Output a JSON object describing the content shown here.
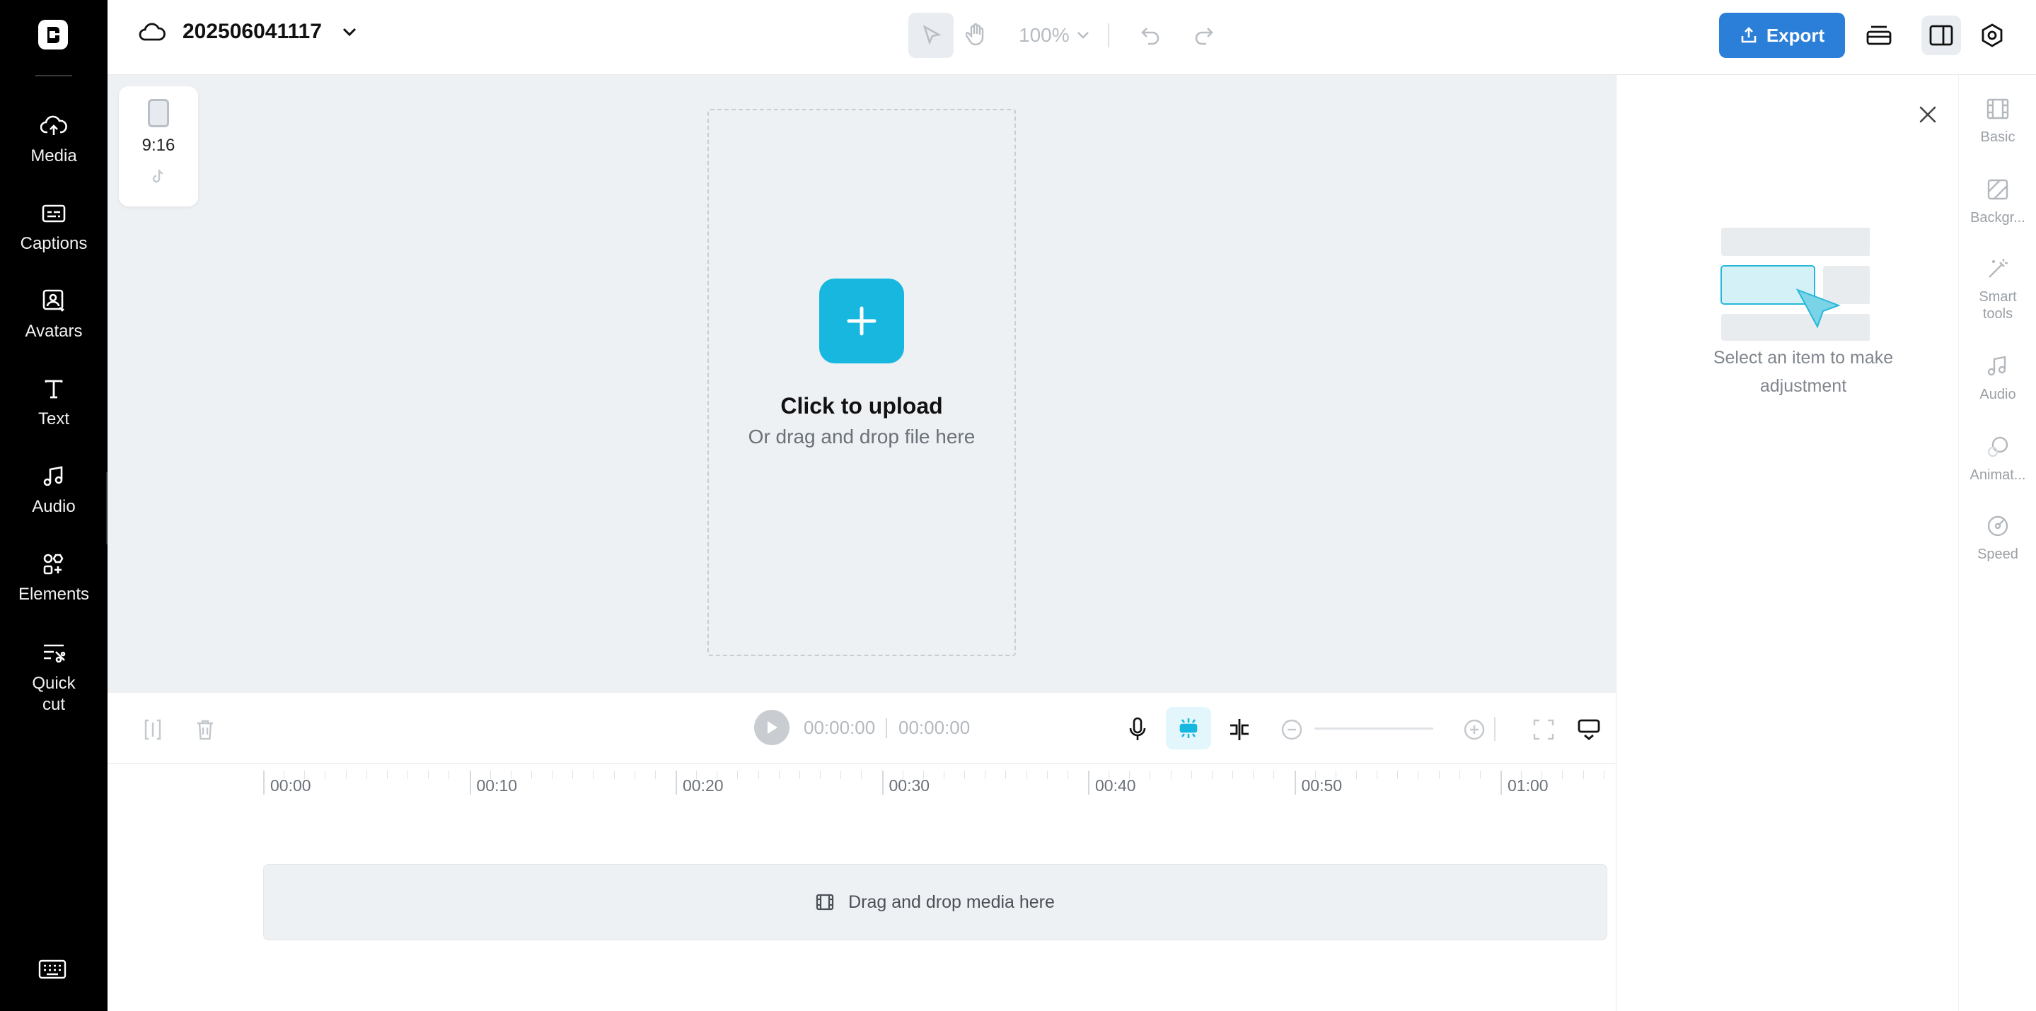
{
  "project": {
    "title": "202506041117"
  },
  "toolbar": {
    "zoom": "100%",
    "export_label": "Export"
  },
  "left_nav": [
    {
      "key": "media",
      "label": "Media",
      "icon": "cloud-upload-icon"
    },
    {
      "key": "captions",
      "label": "Captions",
      "icon": "captions-icon"
    },
    {
      "key": "avatars",
      "label": "Avatars",
      "icon": "avatar-icon"
    },
    {
      "key": "text",
      "label": "Text",
      "icon": "text-icon"
    },
    {
      "key": "audio",
      "label": "Audio",
      "icon": "music-note-icon"
    },
    {
      "key": "elements",
      "label": "Elements",
      "icon": "elements-icon"
    },
    {
      "key": "quickcut",
      "label": "Quick\ncut",
      "icon": "quick-cut-icon"
    }
  ],
  "canvas": {
    "aspect_ratio": "9:16",
    "upload_title": "Click to upload",
    "upload_subtitle": "Or drag and drop file here"
  },
  "playback": {
    "current_time": "00:00:00",
    "total_time": "00:00:00"
  },
  "timeline": {
    "ticks": [
      "00:00",
      "00:10",
      "00:20",
      "00:30",
      "00:40",
      "00:50",
      "01:00"
    ],
    "drop_hint": "Drag and drop media here"
  },
  "right_panel": {
    "hint": "Select an item to make adjustment"
  },
  "right_rail": [
    {
      "key": "basic",
      "label": "Basic"
    },
    {
      "key": "background",
      "label": "Backgr..."
    },
    {
      "key": "smart",
      "label": "Smart\ntools"
    },
    {
      "key": "audio",
      "label": "Audio"
    },
    {
      "key": "animation",
      "label": "Animat..."
    },
    {
      "key": "speed",
      "label": "Speed"
    }
  ],
  "colors": {
    "accent": "#17b7e0",
    "export": "#2b7fd8",
    "rail_bg": "#000000"
  }
}
